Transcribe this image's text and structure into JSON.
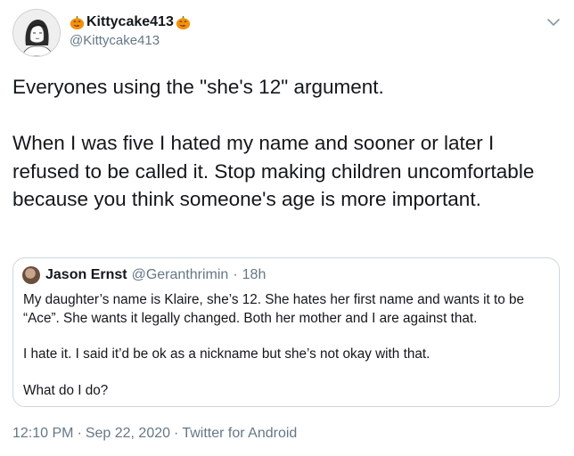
{
  "author": {
    "display_name": "Kittycake413",
    "handle": "@Kittycake413"
  },
  "icons": {
    "avatar": "avatar-sketch-girl",
    "decoration": "jack-o-lantern-icon",
    "menu": "chevron-down-icon"
  },
  "tweet": {
    "text": "Everyones using the \"she's 12\" argument.\n\nWhen I was five I hated my name and sooner or later I refused to be called it. Stop making children uncomfortable because you think someone's age is more important."
  },
  "quoted": {
    "name": "Jason Ernst",
    "handle": "@Geranthrimin",
    "time": "18h",
    "paragraphs": [
      "My daughter’s name is Klaire, she’s 12. She hates her first name and wants it to be “Ace”. She wants it legally changed. Both her mother and I are against that.",
      "I hate it. I said it’d be ok as a nickname but she’s not okay with that.",
      "What do I do?"
    ]
  },
  "footer": {
    "time": "12:10 PM",
    "date": "Sep 22, 2020",
    "source": "Twitter for Android"
  },
  "colors": {
    "text": "#14171a",
    "secondary": "#657786",
    "border": "#ccd6dd",
    "pumpkin": "#f4900c"
  }
}
